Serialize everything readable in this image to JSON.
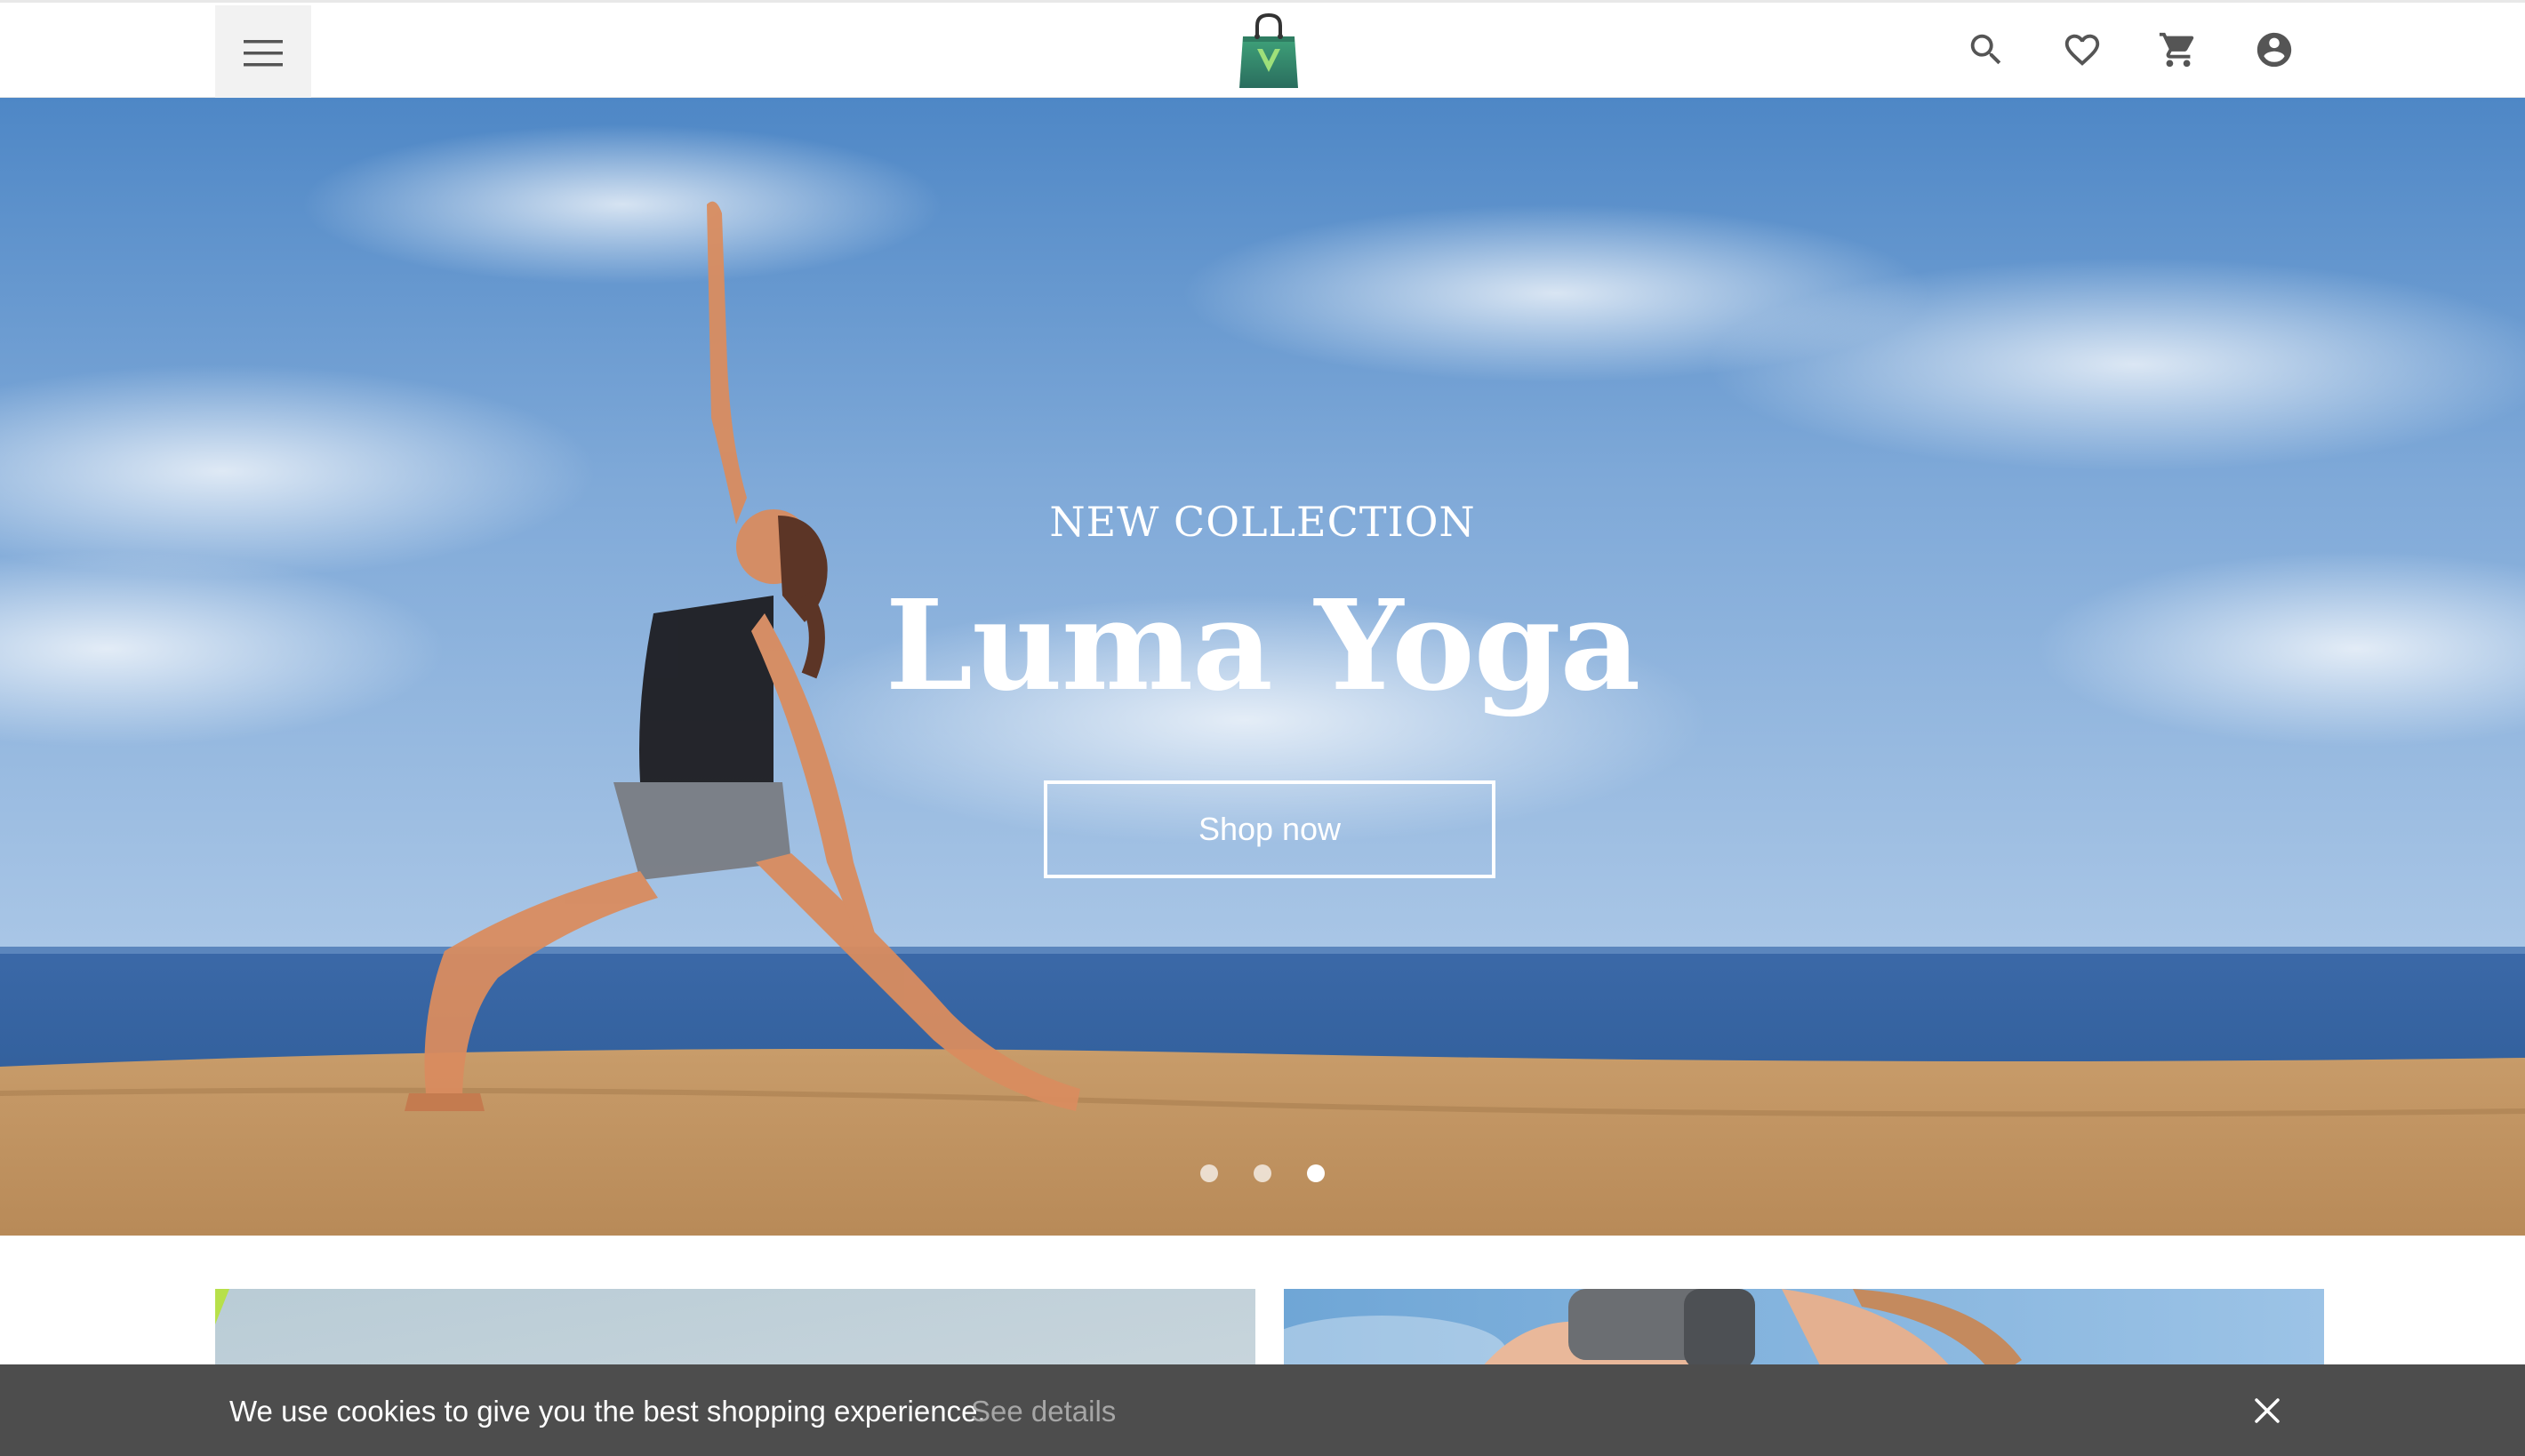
{
  "header": {
    "menu_icon": "hamburger-menu-icon",
    "logo_icon": "shopping-bag-logo",
    "actions": [
      {
        "name": "search",
        "icon": "search-icon"
      },
      {
        "name": "wishlist",
        "icon": "heart-icon"
      },
      {
        "name": "cart",
        "icon": "cart-icon"
      },
      {
        "name": "account",
        "icon": "account-circle-icon"
      }
    ]
  },
  "hero": {
    "kicker": "NEW COLLECTION",
    "title": "Luma Yoga",
    "cta_label": "Shop now",
    "slides_total": 3,
    "active_slide": 3
  },
  "cookie_bar": {
    "message": "We use cookies to give you the best shopping experience.",
    "link_label": "See details",
    "close_icon": "close-icon"
  },
  "colors": {
    "icon_gray": "#555555",
    "logo_green": "#2f8f6a",
    "cookie_bg": "#4d4d4d",
    "cookie_link": "#a6a6a6"
  }
}
